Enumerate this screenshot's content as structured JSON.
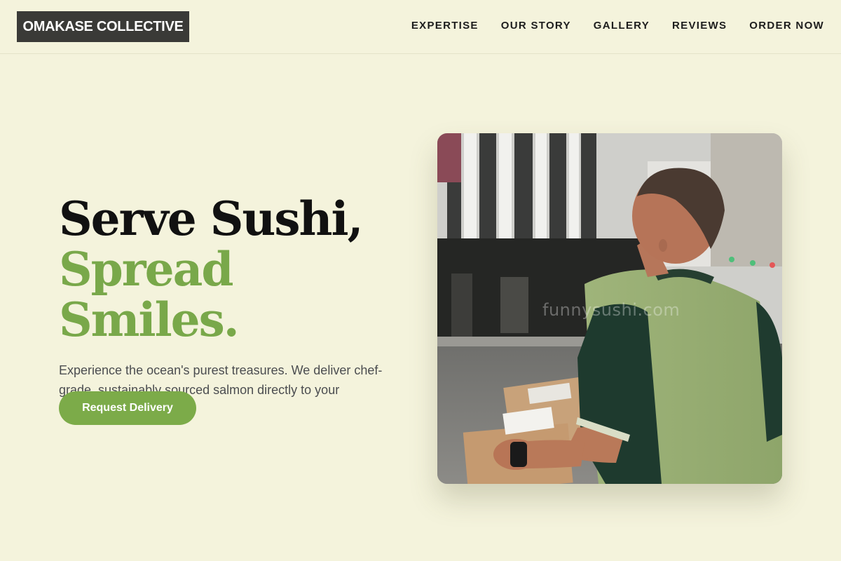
{
  "brand": {
    "name": "OMAKASE COLLECTIVE"
  },
  "nav": {
    "items": [
      {
        "label": "EXPERTISE"
      },
      {
        "label": "OUR STORY"
      },
      {
        "label": "GALLERY"
      },
      {
        "label": "REVIEWS"
      },
      {
        "label": "ORDER NOW"
      }
    ]
  },
  "hero": {
    "headline_line1": "Serve Sushi,",
    "headline_line2": "Spread Smiles.",
    "description": "Experience the ocean's purest treasures. We deliver chef-grade, sustainably sourced salmon directly to your doorstep.",
    "cta_label": "Request Delivery",
    "image": {
      "alt": "Delivery man in green shirt carrying boxes on a city street",
      "watermark": "funnysushi.com"
    }
  },
  "colors": {
    "background": "#f4f3dc",
    "accent_green": "#7cab49",
    "logo_bg": "#3a3a37"
  }
}
